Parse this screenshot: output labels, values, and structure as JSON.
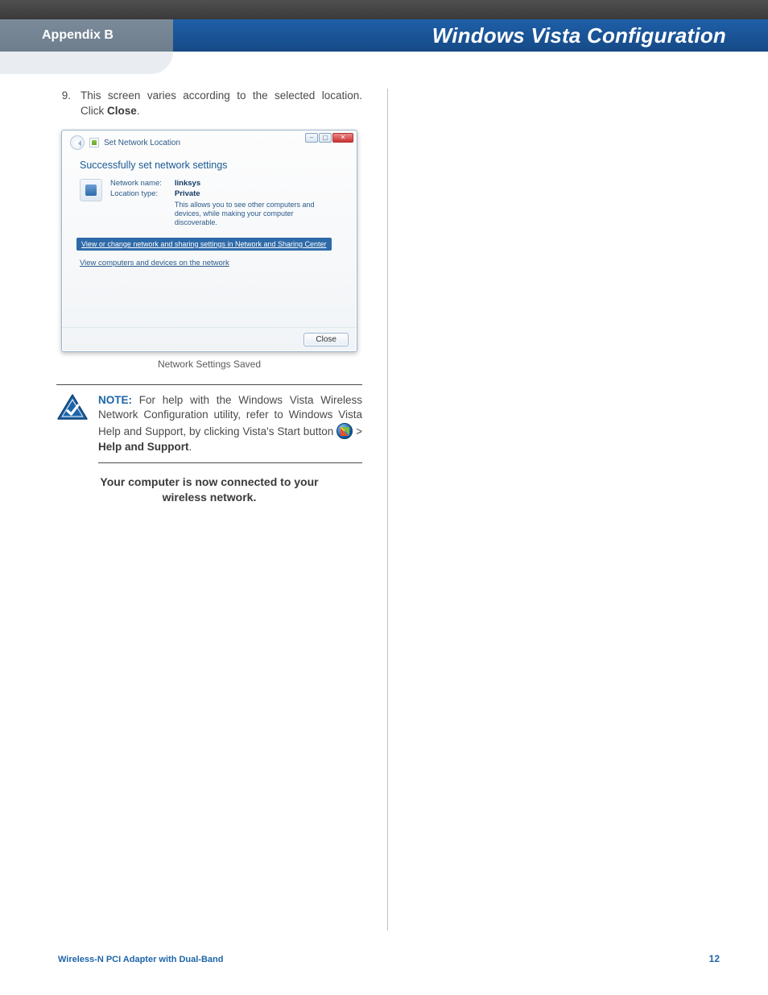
{
  "header": {
    "appendix": "Appendix B",
    "title": "Windows Vista Configuration"
  },
  "step": {
    "number": "9.",
    "text_before_bold": "This screen varies according to the selected location. Click ",
    "bold": "Close",
    "text_after_bold": "."
  },
  "dialog": {
    "breadcrumb": "Set Network Location",
    "heading": "Successfully set network settings",
    "label_network_name": "Network name:",
    "label_location_type": "Location type:",
    "value_network_name": "linksys",
    "value_location_type": "Private",
    "desc": "This allows you to see other computers and devices, while making your computer discoverable.",
    "link1": "View or change network and sharing settings in Network and Sharing Center",
    "link2": "View computers and devices on the network",
    "close_btn": "Close"
  },
  "caption": "Network Settings Saved",
  "note": {
    "lead": "NOTE:",
    "line1": " For help with the Windows Vista Wireless Network Configuration utility, refer to Windows Vista Help and Support, by clicking Vista's Start button ",
    "gt": " > ",
    "bold": "Help and Support",
    "tail": "."
  },
  "conclusion": "Your computer is now connected to your wireless network.",
  "footer": {
    "product": "Wireless-N PCI Adapter with Dual-Band",
    "page": "12"
  }
}
